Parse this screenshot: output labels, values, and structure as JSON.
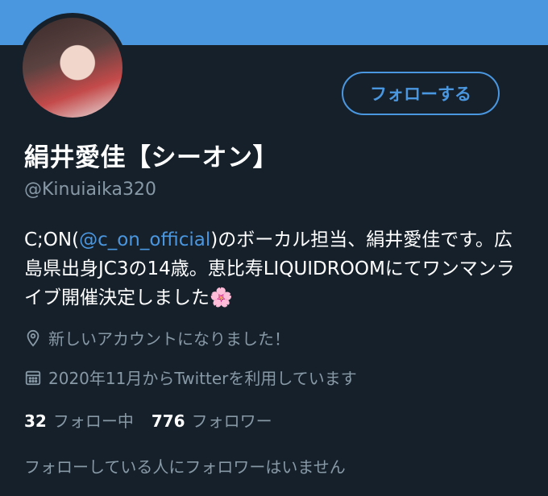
{
  "profile": {
    "display_name": "絹井愛佳【シーオン】",
    "handle": "@Kinuiaika320",
    "follow_label": "フォローする",
    "bio_before": "C;ON(",
    "bio_mention": "@c_on_official",
    "bio_after": ")のボーカル担当、絹井愛佳です。広島県出身JC3の14歳。恵比寿LIQUIDROOMにてワンマンライブ開催決定しました🌸",
    "location": "新しいアカウントになりました！",
    "joined": "2020年11月からTwitterを利用しています",
    "following_count": "32",
    "following_label": "フォロー中",
    "followers_count": "776",
    "followers_label": "フォロワー",
    "no_mutual_note": "フォローしている人にフォロワーはいません"
  },
  "colors": {
    "background": "#15202b",
    "banner": "#4a97e0",
    "accent": "#4a97e0",
    "muted": "#8899a6"
  },
  "icons": {
    "location": "location-pin-icon",
    "joined": "calendar-icon"
  }
}
